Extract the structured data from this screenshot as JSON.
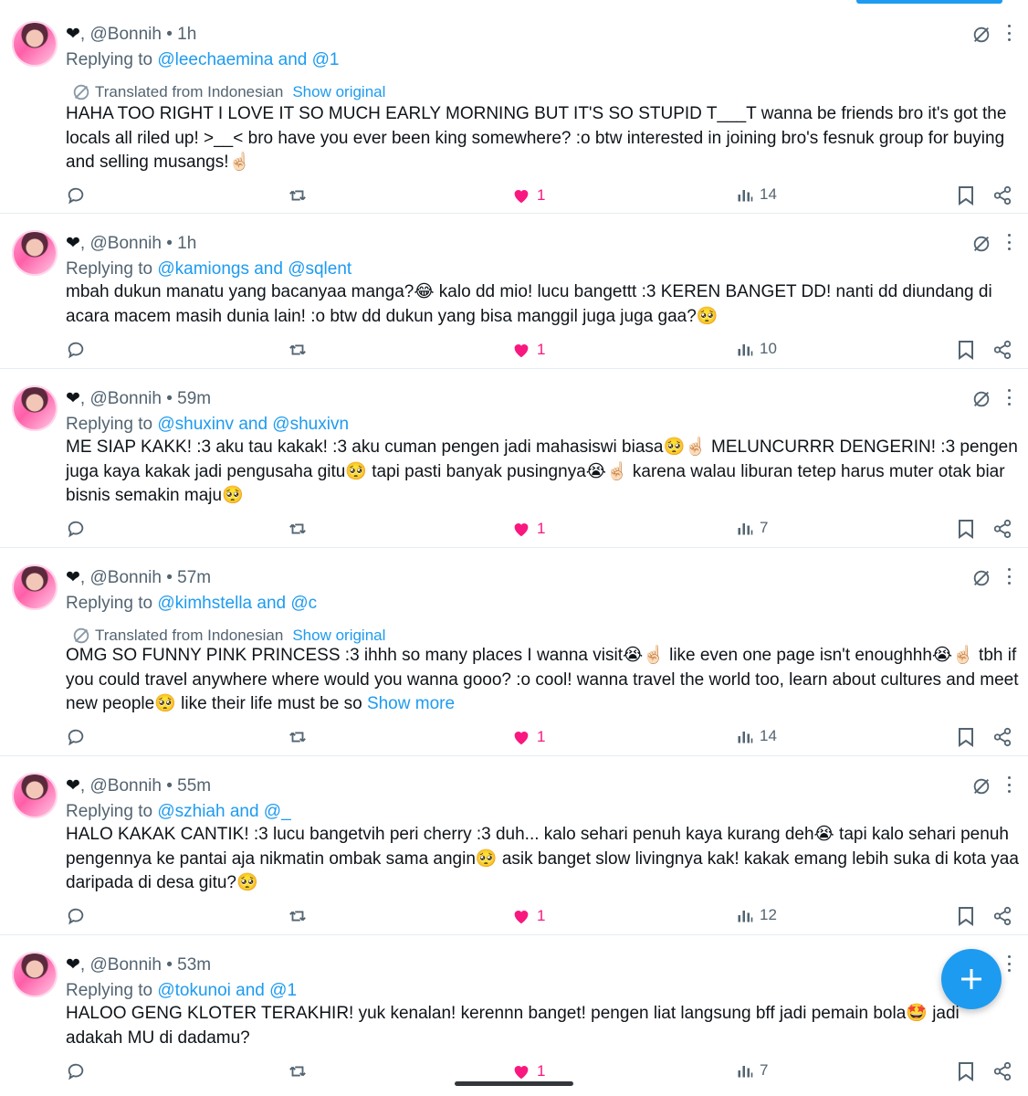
{
  "colors": {
    "accent": "#1d9bf0",
    "like": "#f91880",
    "secondary": "#536471",
    "text": "#0f1419"
  },
  "common": {
    "translated_label": "Translated from Indonesian",
    "show_original": "Show original",
    "heart_glyph": "❤",
    "comma": ",",
    "replying_prefix": "Replying to "
  },
  "tweets": [
    {
      "handle": "@Bonnih",
      "time": "1h",
      "replying_to": "@leechaemina and @1",
      "translated": true,
      "text": "HAHA TOO RIGHT I LOVE IT SO MUCH EARLY MORNING BUT IT'S SO STUPID T___T wanna be friends bro it's got the locals all riled up! >__< bro have you ever been king somewhere? :o btw interested in joining bro's fesnuk group for buying and selling musangs!☝🏻",
      "show_more": "",
      "likes": "1",
      "views": "14"
    },
    {
      "handle": "@Bonnih",
      "time": "1h",
      "replying_to": "@kamiongs and @sqlent",
      "translated": false,
      "text": "mbah dukun manatu yang bacanyaa manga?😂 kalo dd mio! lucu bangettt :3 KEREN BANGET DD! nanti dd diundang di acara macem masih dunia lain! :o btw dd dukun yang bisa manggil juga juga gaa?🥺",
      "show_more": "",
      "likes": "1",
      "views": "10"
    },
    {
      "handle": "@Bonnih",
      "time": "59m",
      "replying_to": "@shuxinv and @shuxivn",
      "translated": false,
      "text": "ME SIAP KAKK! :3 aku tau kakak! :3 aku cuman pengen jadi mahasiswi biasa🥺☝🏻 MELUNCURRR DENGERIN! :3 pengen juga kaya kakak jadi pengusaha gitu🥺 tapi pasti banyak pusingnya😭☝🏻 karena walau liburan tetep harus muter otak biar bisnis semakin maju🥺",
      "show_more": "",
      "likes": "1",
      "views": "7"
    },
    {
      "handle": "@Bonnih",
      "time": "57m",
      "replying_to": "@kimhstella and @c",
      "translated": true,
      "text": "OMG SO FUNNY PINK PRINCESS :3 ihhh so many places I wanna visit😭☝🏻 like even one page isn't enoughhh😭☝🏻 tbh if you could travel anywhere where would you wanna gooo? :o cool! wanna travel the world too, learn about cultures and meet new people🥺 like their life must be so ",
      "show_more": "Show more",
      "likes": "1",
      "views": "14"
    },
    {
      "handle": "@Bonnih",
      "time": "55m",
      "replying_to": "@szhiah and @_",
      "translated": false,
      "text": "HALO KAKAK CANTIK! :3 lucu bangetvih peri cherry :3 duh... kalo sehari penuh kaya kurang deh😭 tapi kalo sehari penuh pengennya ke pantai aja nikmatin ombak sama angin🥺 asik banget slow livingnya kak! kakak emang lebih suka di kota yaa daripada di desa gitu?🥺",
      "show_more": "",
      "likes": "1",
      "views": "12"
    },
    {
      "handle": "@Bonnih",
      "time": "53m",
      "replying_to": "@tokunoi and @1",
      "translated": false,
      "text": "HALOO GENG KLOTER TERAKHIR! yuk kenalan! kerennn banget! pengen liat langsung bff jadi pemain bola🤩 jadi adakah MU di dadamu?",
      "show_more": "",
      "likes": "1",
      "views": "7"
    }
  ],
  "icons": {
    "reply": "reply-icon",
    "retweet": "retweet-icon",
    "like": "heart-icon",
    "views": "views-icon",
    "bookmark": "bookmark-icon",
    "share": "share-icon",
    "grok": "grok-icon",
    "more": "more-dots-icon",
    "compose": "plus-icon"
  }
}
